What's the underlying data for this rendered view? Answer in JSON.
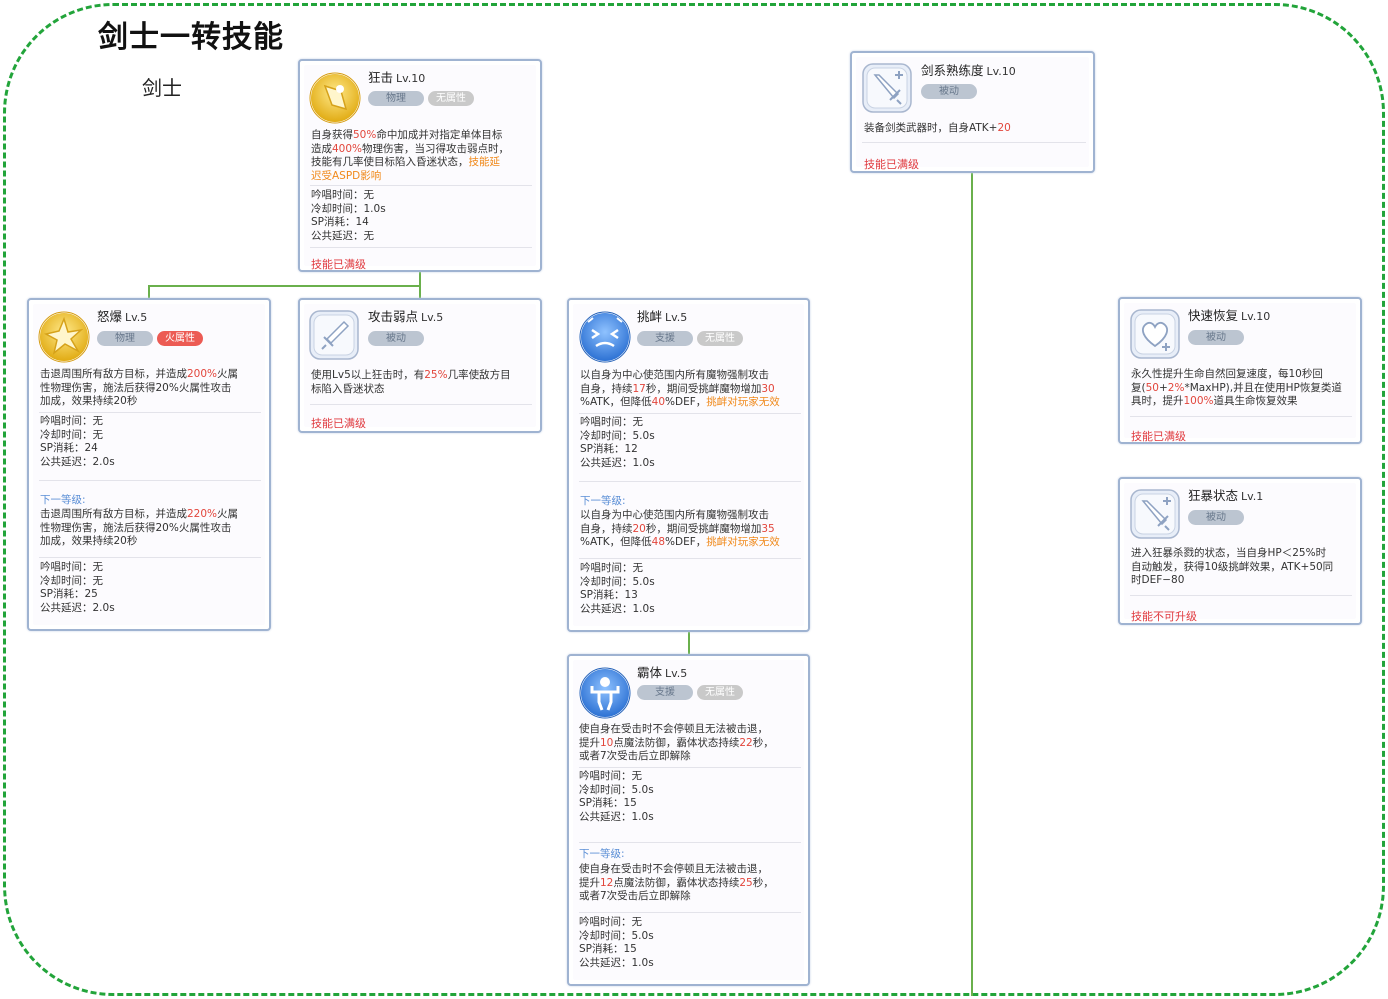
{
  "page": {
    "title": "剑士一转技能",
    "class_label": "剑士"
  },
  "skills": {
    "bash": {
      "name": "狂击",
      "level": "Lv.10",
      "tags": [
        "物理",
        "无属性"
      ],
      "desc_lines": [
        [
          {
            "t": "自身获得"
          },
          {
            "t": "50%",
            "c": "r"
          },
          {
            "t": "命中加成并对指定单体目标"
          }
        ],
        [
          {
            "t": "造成"
          },
          {
            "t": "400%",
            "c": "r"
          },
          {
            "t": "物理伤害，当习得攻击弱点时，"
          }
        ],
        [
          {
            "t": "技能有几率使目标陷入昏迷状态，"
          },
          {
            "t": "技能延",
            "c": "o"
          }
        ],
        [
          {
            "t": "迟受ASPD影响",
            "c": "o"
          }
        ]
      ],
      "stats": [
        "吟唱时间：无",
        "冷却时间：1.0s",
        "SP消耗：14",
        "公共延迟：无"
      ],
      "status": "技能已满级"
    },
    "magnum_break": {
      "name": "怒爆",
      "level": "Lv.5",
      "tags": [
        "物理",
        "火属性"
      ],
      "desc_lines": [
        [
          {
            "t": "击退周围所有敌方目标，并造成"
          },
          {
            "t": "200%",
            "c": "r"
          },
          {
            "t": "火属"
          }
        ],
        [
          {
            "t": "性物理伤害，施法后获得20%火属性攻击"
          }
        ],
        [
          {
            "t": "加成，效果持续20秒"
          }
        ]
      ],
      "stats": [
        "吟唱时间：无",
        "冷却时间：无",
        "SP消耗：24",
        "公共延迟：2.0s"
      ],
      "next_label": "下一等级:",
      "next_desc_lines": [
        [
          {
            "t": "击退周围所有敌方目标，并造成"
          },
          {
            "t": "220%",
            "c": "r"
          },
          {
            "t": "火属"
          }
        ],
        [
          {
            "t": "性物理伤害，施法后获得20%火属性攻击"
          }
        ],
        [
          {
            "t": "加成，效果持续20秒"
          }
        ]
      ],
      "next_stats": [
        "吟唱时间：无",
        "冷却时间：无",
        "SP消耗：25",
        "公共延迟：2.0s"
      ]
    },
    "fatal_blow": {
      "name": "攻击弱点",
      "level": "Lv.5",
      "tags": [
        "被动"
      ],
      "desc_lines": [
        [
          {
            "t": "使用Lv5以上狂击时，有"
          },
          {
            "t": "25%",
            "c": "r"
          },
          {
            "t": "几率使敌方目"
          }
        ],
        [
          {
            "t": "标陷入昏迷状态"
          }
        ]
      ],
      "status": "技能已满级"
    },
    "provoke": {
      "name": "挑衅",
      "level": "Lv.5",
      "tags": [
        "支援",
        "无属性"
      ],
      "desc_lines": [
        [
          {
            "t": "以自身为中心使范围内所有魔物强制攻击"
          }
        ],
        [
          {
            "t": "自身，持续"
          },
          {
            "t": "17",
            "c": "r"
          },
          {
            "t": "秒，期间受挑衅魔物增加"
          },
          {
            "t": "30",
            "c": "r"
          }
        ],
        [
          {
            "t": "%ATK，但降低"
          },
          {
            "t": "40",
            "c": "r"
          },
          {
            "t": "%DEF，"
          },
          {
            "t": "挑衅对玩家无效",
            "c": "o"
          }
        ]
      ],
      "stats": [
        "吟唱时间：无",
        "冷却时间：5.0s",
        "SP消耗：12",
        "公共延迟：1.0s"
      ],
      "next_label": "下一等级:",
      "next_desc_lines": [
        [
          {
            "t": "以自身为中心使范围内所有魔物强制攻击"
          }
        ],
        [
          {
            "t": "自身，持续"
          },
          {
            "t": "20",
            "c": "r"
          },
          {
            "t": "秒，期间受挑衅魔物增加"
          },
          {
            "t": "35",
            "c": "r"
          }
        ],
        [
          {
            "t": "%ATK，但降低"
          },
          {
            "t": "48",
            "c": "r"
          },
          {
            "t": "%DEF，"
          },
          {
            "t": "挑衅对玩家无效",
            "c": "o"
          }
        ]
      ],
      "next_stats": [
        "吟唱时间：无",
        "冷却时间：5.0s",
        "SP消耗：13",
        "公共延迟：1.0s"
      ]
    },
    "endure": {
      "name": "霸体",
      "level": "Lv.5",
      "tags": [
        "支援",
        "无属性"
      ],
      "desc_lines": [
        [
          {
            "t": "使自身在受击时不会停顿且无法被击退，"
          }
        ],
        [
          {
            "t": "提升"
          },
          {
            "t": "10",
            "c": "r"
          },
          {
            "t": "点魔法防御，霸体状态持续"
          },
          {
            "t": "22",
            "c": "r"
          },
          {
            "t": "秒，"
          }
        ],
        [
          {
            "t": "或者7次受击后立即解除"
          }
        ]
      ],
      "stats": [
        "吟唱时间：无",
        "冷却时间：5.0s",
        "SP消耗：15",
        "公共延迟：1.0s"
      ],
      "next_label": "下一等级:",
      "next_desc_lines": [
        [
          {
            "t": "使自身在受击时不会停顿且无法被击退，"
          }
        ],
        [
          {
            "t": "提升"
          },
          {
            "t": "12",
            "c": "r"
          },
          {
            "t": "点魔法防御，霸体状态持续"
          },
          {
            "t": "25",
            "c": "r"
          },
          {
            "t": "秒，"
          }
        ],
        [
          {
            "t": "或者7次受击后立即解除"
          }
        ]
      ],
      "next_stats": [
        "吟唱时间：无",
        "冷却时间：5.0s",
        "SP消耗：15",
        "公共延迟：1.0s"
      ]
    },
    "sword_mastery": {
      "name": "剑系熟练度",
      "level": "Lv.10",
      "tags": [
        "被动"
      ],
      "desc_lines": [
        [
          {
            "t": "装备剑类武器时，自身ATK+"
          },
          {
            "t": "20",
            "c": "r"
          }
        ]
      ],
      "status": "技能已满级"
    },
    "hp_recovery": {
      "name": "快速恢复",
      "level": "Lv.10",
      "tags": [
        "被动"
      ],
      "desc_lines": [
        [
          {
            "t": "永久性提升生命自然回复速度，每10秒回"
          }
        ],
        [
          {
            "t": "复("
          },
          {
            "t": "50",
            "c": "r"
          },
          {
            "t": "+"
          },
          {
            "t": "2%",
            "c": "r"
          },
          {
            "t": "*MaxHP),并且在使用HP恢复类道"
          }
        ],
        [
          {
            "t": "具时，提升"
          },
          {
            "t": "100%",
            "c": "r"
          },
          {
            "t": "道具生命恢复效果"
          }
        ]
      ],
      "status": "技能已满级"
    },
    "berserk": {
      "name": "狂暴状态",
      "level": "Lv.1",
      "tags": [
        "被动"
      ],
      "desc_lines": [
        [
          {
            "t": "进入狂暴杀戮的状态，当自身HP＜25%时"
          }
        ],
        [
          {
            "t": "自动触发，获得10级挑衅效果，ATK+50同"
          }
        ],
        [
          {
            "t": "时DEF−80"
          }
        ]
      ],
      "status": "技能不可升级"
    }
  },
  "colors": {
    "frame": "#22a43a",
    "connector": "#6ab04c",
    "maxed": "#e0393e",
    "next_level": "#5b8fd6",
    "highlight_red": "#e2463c",
    "highlight_orange": "#f08a1c"
  },
  "icons": {
    "bash": "star-burst-icon",
    "magnum_break": "explosion-star-icon",
    "fatal_blow": "sword-icon",
    "provoke": "taunt-face-icon",
    "endure": "flex-figure-icon",
    "sword_mastery": "sword-plus-icon",
    "hp_recovery": "heart-plus-icon",
    "berserk": "sword-plus-icon"
  }
}
